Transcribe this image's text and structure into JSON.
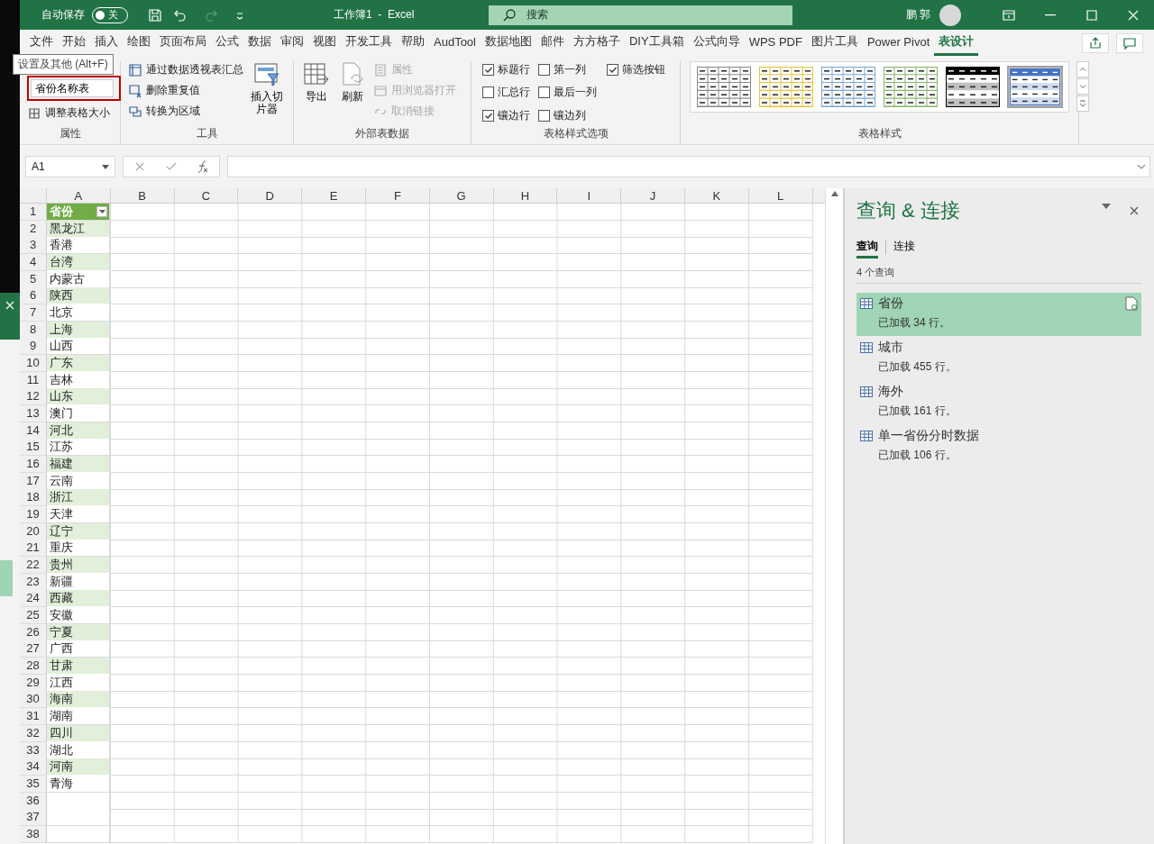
{
  "title_bar": {
    "autosave_label": "自动保存",
    "autosave": {
      "label": "关",
      "on": false
    },
    "title": "工作簿1  -  Excel",
    "search_placeholder": "搜索",
    "user": "鹏 郭"
  },
  "menu_tabs": [
    {
      "label": "文件",
      "selected": false
    },
    {
      "label": "开始",
      "selected": false
    },
    {
      "label": "插入",
      "selected": false
    },
    {
      "label": "绘图",
      "selected": false
    },
    {
      "label": "页面布局",
      "selected": false
    },
    {
      "label": "公式",
      "selected": false
    },
    {
      "label": "数据",
      "selected": false
    },
    {
      "label": "审阅",
      "selected": false
    },
    {
      "label": "视图",
      "selected": false
    },
    {
      "label": "开发工具",
      "selected": false
    },
    {
      "label": "帮助",
      "selected": false
    },
    {
      "label": "AudTool",
      "selected": false
    },
    {
      "label": "数据地图",
      "selected": false
    },
    {
      "label": "邮件",
      "selected": false
    },
    {
      "label": "方方格子",
      "selected": false
    },
    {
      "label": "DIY工具箱",
      "selected": false
    },
    {
      "label": "公式向导",
      "selected": false
    },
    {
      "label": "WPS PDF",
      "selected": false
    },
    {
      "label": "图片工具",
      "selected": false
    },
    {
      "label": "Power Pivot",
      "selected": false
    },
    {
      "label": "表设计",
      "selected": true
    }
  ],
  "ribbon": {
    "properties": {
      "label": "属性",
      "tooltip": "设置及其他 (Alt+F)",
      "table_name": "省份名称表",
      "resize": "调整表格大小"
    },
    "tools": {
      "label": "工具",
      "items": [
        {
          "label": "通过数据透视表汇总"
        },
        {
          "label": "删除重复值"
        },
        {
          "label": "转换为区域"
        }
      ],
      "slicer": "插入切片器"
    },
    "external": {
      "label": "外部表数据",
      "export": "导出",
      "refresh": "刷新",
      "items": [
        {
          "label": "属性",
          "disabled": true
        },
        {
          "label": "用浏览器打开",
          "disabled": true
        },
        {
          "label": "取消链接",
          "disabled": true
        }
      ]
    },
    "style_options": {
      "label": "表格样式选项",
      "options": [
        {
          "label": "标题行",
          "checked": true
        },
        {
          "label": "第一列",
          "checked": false
        },
        {
          "label": "筛选按钮",
          "checked": true
        },
        {
          "label": "汇总行",
          "checked": false
        },
        {
          "label": "最后一列",
          "checked": false
        },
        {
          "label": "镶边行",
          "checked": true
        },
        {
          "label": "镶边列",
          "checked": false
        }
      ]
    },
    "styles": {
      "label": "表格样式",
      "items": [
        {
          "kind": "grid",
          "color": "#8a8a8a",
          "selected": false
        },
        {
          "kind": "grid",
          "color": "#e6c440",
          "selected": false
        },
        {
          "kind": "grid",
          "color": "#7aa7d6",
          "selected": false
        },
        {
          "kind": "grid",
          "color": "#86b86a",
          "selected": false
        },
        {
          "kind": "banded",
          "color": "#000000",
          "selected": false
        },
        {
          "kind": "banded",
          "color": "#4472c4",
          "selected": true
        }
      ]
    }
  },
  "formula_bar": {
    "name_box": "A1"
  },
  "sheet": {
    "columns": [
      "A",
      "B",
      "C",
      "D",
      "E",
      "F",
      "G",
      "H",
      "I",
      "J",
      "K",
      "L"
    ],
    "rows": [
      {
        "n": "1",
        "value": "省份",
        "header": true
      },
      {
        "n": "2",
        "value": "黑龙江"
      },
      {
        "n": "3",
        "value": "香港"
      },
      {
        "n": "4",
        "value": "台湾"
      },
      {
        "n": "5",
        "value": "内蒙古"
      },
      {
        "n": "6",
        "value": "陕西"
      },
      {
        "n": "7",
        "value": "北京"
      },
      {
        "n": "8",
        "value": "上海"
      },
      {
        "n": "9",
        "value": "山西"
      },
      {
        "n": "10",
        "value": "广东"
      },
      {
        "n": "11",
        "value": "吉林"
      },
      {
        "n": "12",
        "value": "山东"
      },
      {
        "n": "13",
        "value": "澳门"
      },
      {
        "n": "14",
        "value": "河北"
      },
      {
        "n": "15",
        "value": "江苏"
      },
      {
        "n": "16",
        "value": "福建"
      },
      {
        "n": "17",
        "value": "云南"
      },
      {
        "n": "18",
        "value": "浙江"
      },
      {
        "n": "19",
        "value": "天津"
      },
      {
        "n": "20",
        "value": "辽宁"
      },
      {
        "n": "21",
        "value": "重庆"
      },
      {
        "n": "22",
        "value": "贵州"
      },
      {
        "n": "23",
        "value": "新疆"
      },
      {
        "n": "24",
        "value": "西藏"
      },
      {
        "n": "25",
        "value": "安徽"
      },
      {
        "n": "26",
        "value": "宁夏"
      },
      {
        "n": "27",
        "value": "广西"
      },
      {
        "n": "28",
        "value": "甘肃"
      },
      {
        "n": "29",
        "value": "江西"
      },
      {
        "n": "30",
        "value": "海南"
      },
      {
        "n": "31",
        "value": "湖南"
      },
      {
        "n": "32",
        "value": "四川"
      },
      {
        "n": "33",
        "value": "湖北"
      },
      {
        "n": "34",
        "value": "河南"
      },
      {
        "n": "35",
        "value": "青海"
      },
      {
        "n": "36"
      },
      {
        "n": "37"
      },
      {
        "n": "38"
      }
    ]
  },
  "queries_pane": {
    "title": "查询 & 连接",
    "tabs": [
      {
        "label": "查询",
        "selected": true
      },
      {
        "label": "连接",
        "selected": false
      }
    ],
    "count": "4 个查询",
    "queries": [
      {
        "name": "省份",
        "status": "已加载 34 行。",
        "selected": true
      },
      {
        "name": "城市",
        "status": "已加载 455 行。",
        "selected": false
      },
      {
        "name": "海外",
        "status": "已加载 161 行。",
        "selected": false
      },
      {
        "name": "单一省份分时数据",
        "status": "已加载 106 行。",
        "selected": false
      }
    ]
  }
}
